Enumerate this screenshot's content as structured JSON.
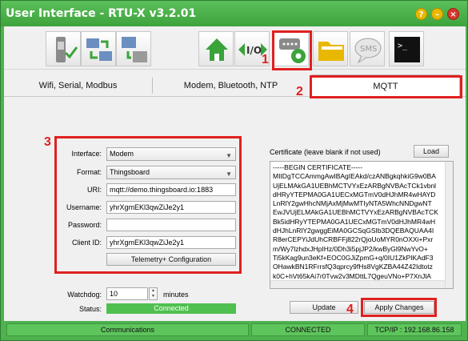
{
  "window": {
    "title": "User Interface - RTU-X v3.2.01",
    "help_label": "?",
    "minimize_label": "–",
    "close_label": "×"
  },
  "toolbar": {
    "buttons": [
      {
        "icon": "switch-connect-icon"
      },
      {
        "icon": "import-export-icon"
      },
      {
        "icon": "rtu-transfer-icon"
      },
      {
        "icon": "home-icon"
      },
      {
        "icon": "io-icon"
      },
      {
        "icon": "port-settings-gear-icon"
      },
      {
        "icon": "folder-icon"
      },
      {
        "icon": "sms-icon"
      },
      {
        "icon": "terminal-icon"
      }
    ],
    "active_index": 5
  },
  "tabs": [
    {
      "label": "Wifi, Serial, Modbus"
    },
    {
      "label": "Modem, Bluetooth, NTP"
    },
    {
      "label": "MQTT"
    }
  ],
  "form": {
    "interface_label": "Interface:",
    "interface_value": "Modem",
    "format_label": "Format:",
    "format_value": "Thingsboard",
    "uri_label": "URI:",
    "uri_value": "mqtt://demo.thingsboard.io:1883",
    "username_label": "Username:",
    "username_value": "yhrXgmEKl3qwZiJe2y1",
    "password_label": "Password:",
    "password_value": "",
    "clientid_label": "Client ID:",
    "clientid_value": "yhrXgmEKl3qwZiJe2y1",
    "telemetry_button": "Telemetry+ Configuration",
    "watchdog_label": "Watchdog:",
    "watchdog_value": "10",
    "watchdog_unit": "minutes",
    "status_label": "Status:",
    "status_value": "Connected"
  },
  "certificate": {
    "label": "Certificate (leave blank if not used)",
    "load_button": "Load",
    "lines": [
      "-----BEGIN CERTIFICATE-----",
      "MIIDgTCCAmmgAwIBAgIEAkd/czANBgkqhkiG9w0BA",
      "UjELMAkGA1UEBhMCTVYxEzARBgNVBAcTCk1vbnl",
      "dHRyYTEPMA0GA1UECxMGTmV0dHJhMR4wHAYD",
      "LnRlY2gwHhcNMjAxMjMwMTIyNTA5WhcNNDgwNT",
      "EwJVUjELMAkGA1UEBhMCTVYxEzARBgNVBAcTCK",
      "Bk5idHRyYTEPMA0GA1UECxMGTmV0dHJhMR4wH",
      "dHJhLnRlY2gwggEiMA0GCSqGSIb3DQEBAQUAA4I",
      "R8erCEPYiJdUhCRBFFj822rQjoUoMYR0nOXXi+Pxr",
      "m/Wy7lzhdxJHpIHz/0Dh3i5pjJP2/kwByGl9NwYvO+",
      "Ti5kKag9un3eKf+EOC0GJiZpmG+q/0IU1ZkPIKAdF3",
      "OHawkBN1RFrrsfQ3qprcy9fHs8VgKZBA44Z42Idtotz",
      "k0C+hVt65kAi7r0Tvw2v3MDttL7QgeuVNo+P7XnJlA"
    ]
  },
  "actions": {
    "update_button": "Update",
    "apply_button": "Apply Changes"
  },
  "annotations": {
    "n1": "1",
    "n2": "2",
    "n3": "3",
    "n4": "4"
  },
  "statusbar": {
    "section": "Communications",
    "connection": "CONNECTED",
    "address": "TCP/IP : 192.168.86.158"
  },
  "colors": {
    "accent_green": "#4fb14f",
    "highlight_red": "#e02020",
    "status_connected": "#4fc04f"
  }
}
